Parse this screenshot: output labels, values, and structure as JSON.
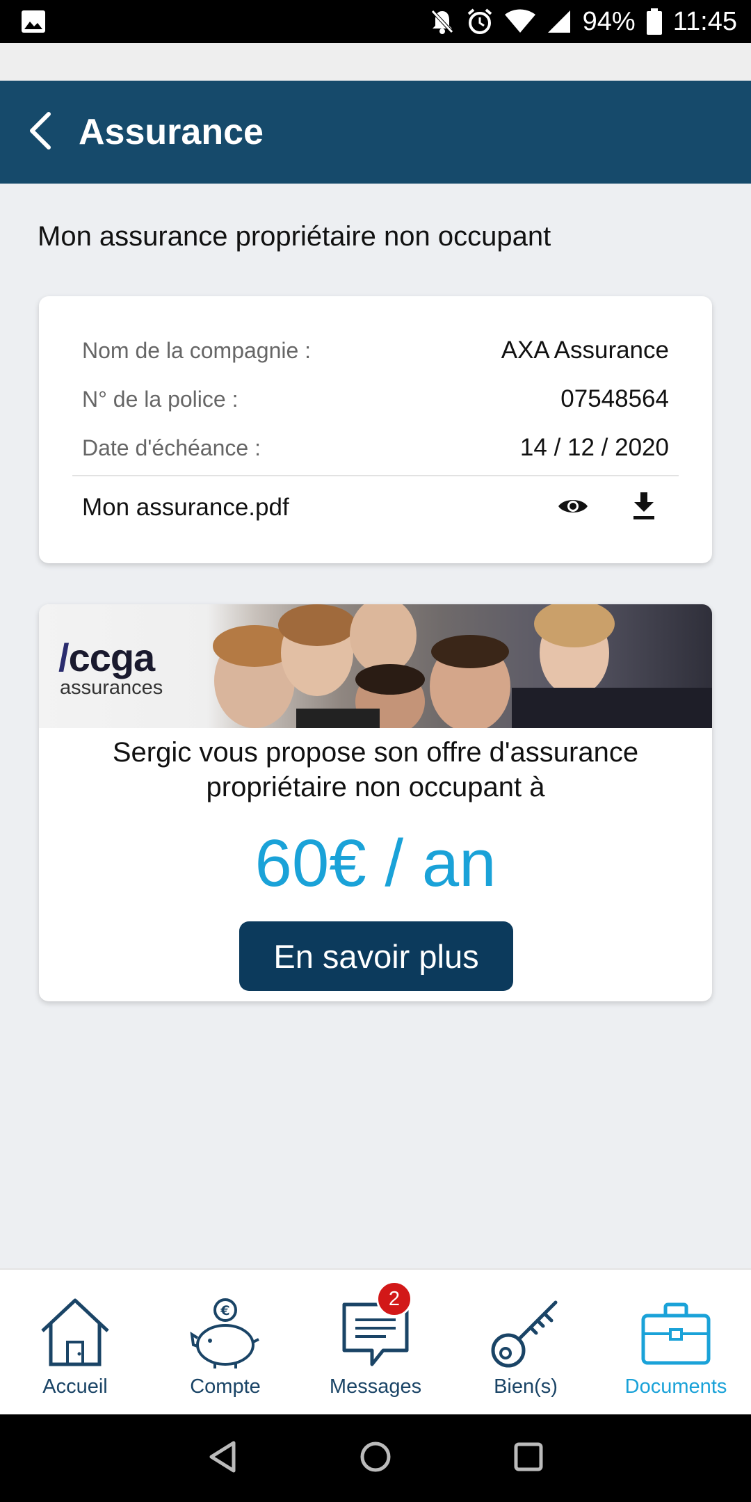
{
  "status_bar": {
    "battery": "94%",
    "time": "11:45",
    "icons": [
      "image-icon",
      "mute-bell-icon",
      "alarm-icon",
      "wifi-icon",
      "signal-icon",
      "battery-icon"
    ]
  },
  "app_bar": {
    "title": "Assurance",
    "back_icon": "chevron-left-icon"
  },
  "section_title": "Mon assurance propriétaire non occupant",
  "policy": {
    "company_label": "Nom de la compagnie :",
    "company_value": "AXA Assurance",
    "policy_label": "N° de la police :",
    "policy_value": "07548564",
    "due_label": "Date d'échéance :",
    "due_value": "14 / 12 / 2020",
    "file_name": "Mon assurance.pdf",
    "view_icon": "eye-icon",
    "download_icon": "download-icon"
  },
  "offer": {
    "logo_main": "ccga",
    "logo_sub": "assurances",
    "text": "Sergic vous propose son offre d'assurance propriétaire non occupant à",
    "price": "60€ / an",
    "cta_label": "En savoir plus"
  },
  "bottom_nav": {
    "items": [
      {
        "label": "Accueil",
        "icon": "house-icon",
        "active": false
      },
      {
        "label": "Compte",
        "icon": "piggy-bank-icon",
        "active": false
      },
      {
        "label": "Messages",
        "icon": "message-icon",
        "active": false,
        "badge": "2"
      },
      {
        "label": "Bien(s)",
        "icon": "key-icon",
        "active": false
      },
      {
        "label": "Documents",
        "icon": "briefcase-icon",
        "active": true
      }
    ]
  },
  "colors": {
    "app_bar": "#164a6b",
    "accent": "#1aa2d8",
    "button": "#0c3a5c",
    "badge": "#d21818",
    "nav_text": "#1a4466"
  }
}
